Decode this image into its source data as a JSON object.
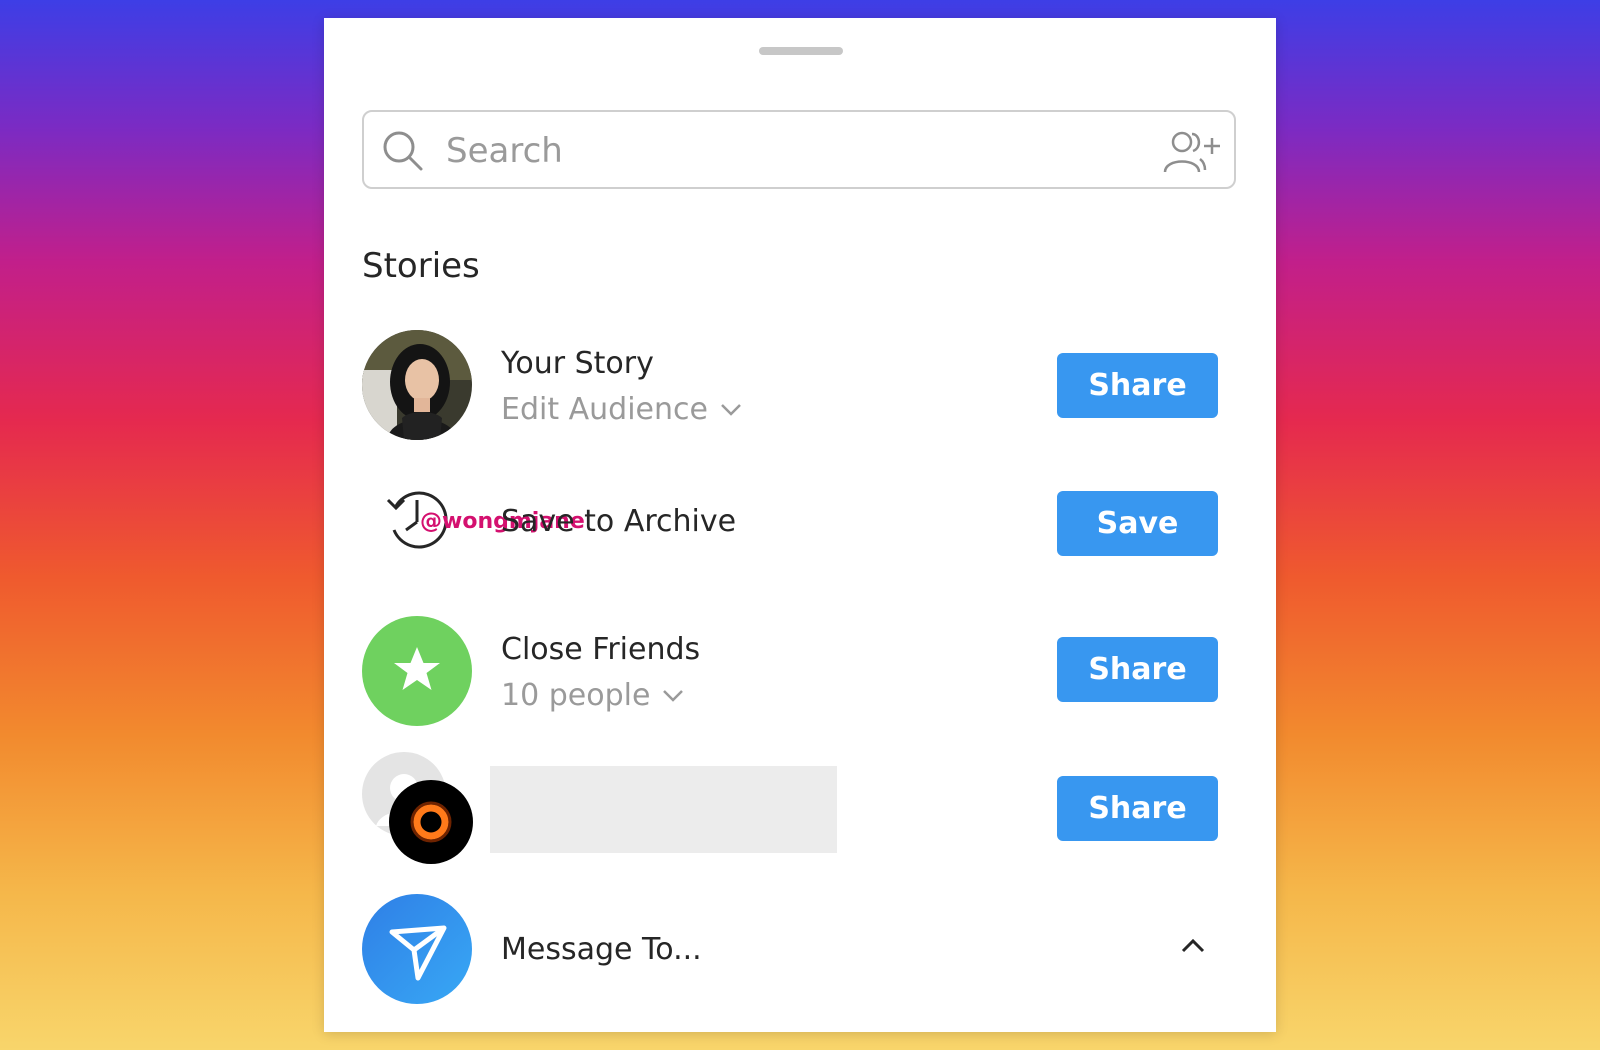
{
  "search": {
    "placeholder": "Search",
    "icon": "search-icon",
    "add_icon": "add-people-icon"
  },
  "stories": {
    "section_title": "Stories",
    "your_story": {
      "title": "Your Story",
      "subtitle": "Edit Audience",
      "button": "Share"
    },
    "archive": {
      "title": "Save to Archive",
      "watermark": "@wongmjane",
      "button": "Save"
    },
    "close_friends": {
      "title": "Close Friends",
      "subtitle": "10 people",
      "button": "Share"
    },
    "group_story": {
      "button": "Share"
    },
    "message": {
      "title": "Message To..."
    }
  },
  "colors": {
    "button_blue": "#3897f0",
    "close_friends_green": "#6fd15f",
    "message_blue": "#2f8ff0",
    "watermark_pink": "#d4106f"
  }
}
